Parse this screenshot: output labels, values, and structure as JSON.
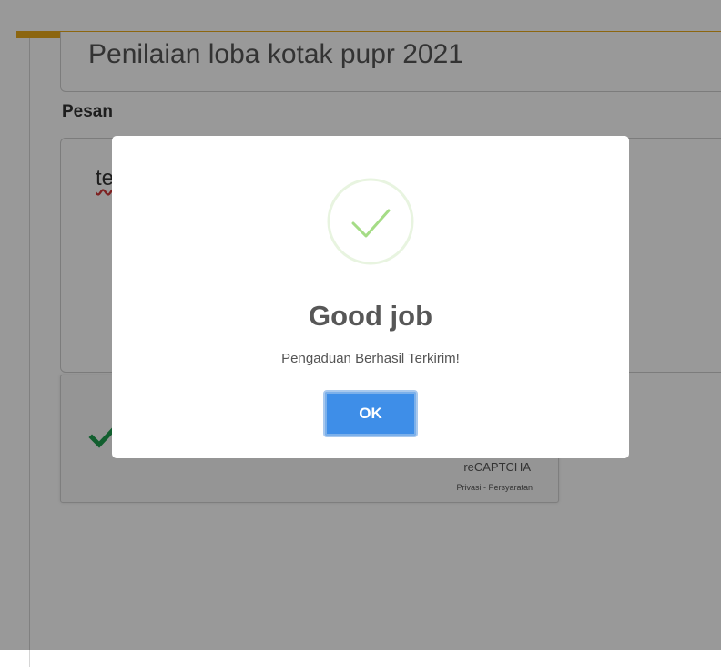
{
  "form": {
    "subject_value": "Penilaian loba kotak pupr 2021",
    "message_label": "Pesan",
    "message_value": "te"
  },
  "recaptcha": {
    "brand": "reCAPTCHA",
    "links": "Privasi - Persyaratan",
    "status": "verified",
    "check_icon": "checkmark-icon",
    "check_color": "#1e9f4f"
  },
  "dialog": {
    "icon": "success-check-icon",
    "title": "Good job",
    "text": "Pengaduan Berhasil Terkirim!",
    "ok_label": "OK"
  },
  "colors": {
    "accent": "#eaaa1c",
    "button": "#3e8ee8",
    "success": "#a5dc86"
  }
}
